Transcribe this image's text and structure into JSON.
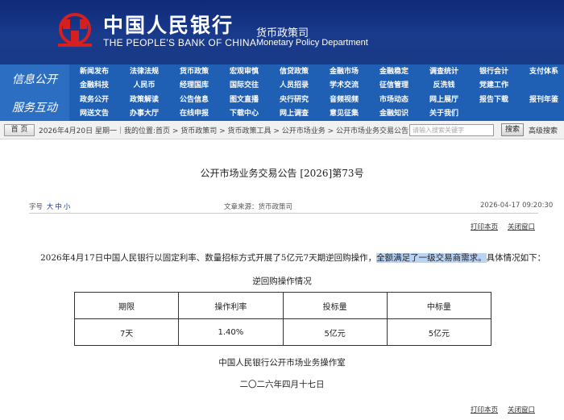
{
  "header": {
    "org_cn": "中国人民银行",
    "org_en": "THE PEOPLE'S BANK OF CHINA",
    "dept_cn": "货币政策司",
    "dept_en": "Monetary Policy Department",
    "logo_icon": "pboc-logo-icon"
  },
  "nav": {
    "block1": "信息公开",
    "block2": "服务互动",
    "row1": [
      "新闻发布",
      "法律法规",
      "货币政策",
      "宏观审慎",
      "信贷政策",
      "金融市场",
      "金融稳定",
      "调查统计",
      "银行会计",
      "支付体系"
    ],
    "row2": [
      "金融科技",
      "人民币",
      "经理国库",
      "国际交往",
      "人员招录",
      "学术交流",
      "征信管理",
      "反洗钱",
      "党建工作"
    ],
    "row3": [
      "政务公开",
      "政策解读",
      "公告信息",
      "图文直播",
      "央行研究",
      "音频视频",
      "市场动态",
      "网上展厅",
      "报告下载",
      "报刊年鉴"
    ],
    "row4": [
      "网送文告",
      "办事大厅",
      "在线申报",
      "下载中心",
      "网上调查",
      "意见征集",
      "金融知识",
      "关于我们"
    ]
  },
  "breadcrumb": {
    "home": "首 页",
    "text": "2026年4月20日 星期一｜我的位置:首页 > 货币政策司 > 货币政策工具 > 公开市场业务 > 公开市场业务交易公告",
    "search_placeholder": "请输入搜索关键字",
    "search_button": "搜索",
    "advanced": "高级搜索"
  },
  "article": {
    "title": "公开市场业务交易公告 [2026]第73号",
    "font_label": "字号",
    "font_sizes": [
      "大",
      "中",
      "小"
    ],
    "source": "文章来源：货币政策司",
    "date": "2026-04-17 09:20:30",
    "print": "打印本页",
    "close": "关闭窗口",
    "para_before": "2026年4月17日中国人民银行以固定利率、数量招标方式开展了5亿元7天期逆回购操作，",
    "para_highlight": "全额满足了一级交易商需求。",
    "para_after": "具体情况如下：",
    "table_title": "逆回购操作情况",
    "table_headers": [
      "期限",
      "操作利率",
      "投标量",
      "中标量"
    ],
    "table_row": [
      "7天",
      "1.40%",
      "5亿元",
      "5亿元"
    ],
    "sign_org": "中国人民银行公开市场业务操作室",
    "sign_date": "二〇二六年四月十七日"
  },
  "colors": {
    "header_bg": "#1a3a8c",
    "nav_bg": "#1f5fb4",
    "highlight": "#b9d3f3",
    "logo_red": "#d61f1f"
  }
}
